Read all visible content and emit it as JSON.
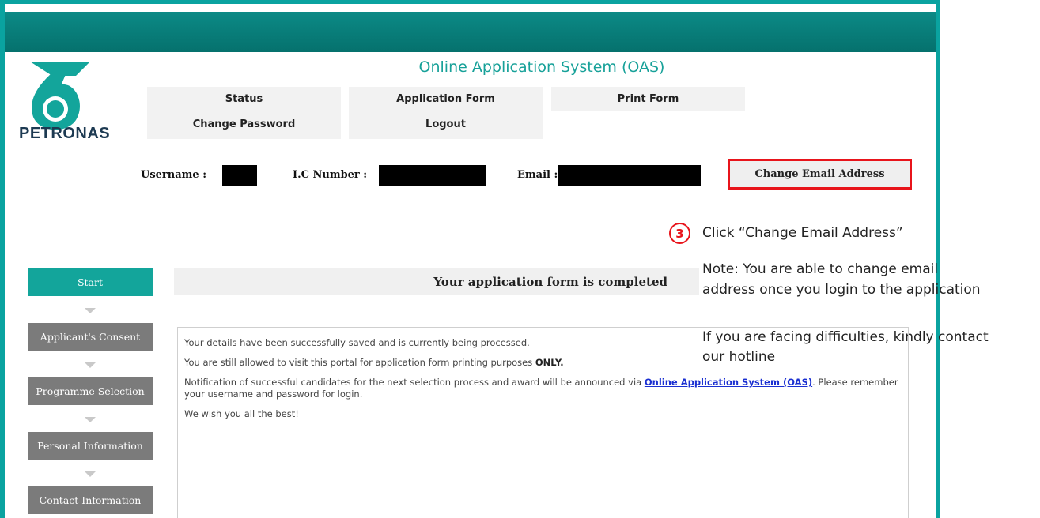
{
  "brand": {
    "logo_text": "PETRONAS",
    "accent": "#0aa3a0",
    "highlight": "#e8141b"
  },
  "header": {
    "title": "Online Application System (OAS)"
  },
  "menu": {
    "status": "Status",
    "change_password": "Change Password",
    "application_form": "Application Form",
    "logout": "Logout",
    "print_form": "Print Form"
  },
  "user_info": {
    "username_label": "Username :",
    "ic_label": "I.C Number :",
    "email_label": "Email :",
    "change_email_button": "Change Email Address"
  },
  "callout": {
    "step_number": "3",
    "instruction": "Click “Change Email Address”",
    "note_line1": "Note: You are able to change email",
    "note_line2": "address once you login to the application",
    "help_line1": "If you are facing difficulties, kindly contact",
    "help_line2": "our hotline"
  },
  "sidebar": {
    "steps": [
      "Start",
      "Applicant's Consent",
      "Programme Selection",
      "Personal Information",
      "Contact Information"
    ]
  },
  "content": {
    "heading": "Your application form is completed",
    "line1": "Your details have been successfully saved and is currently being processed.",
    "line2_pre": "You are still allowed to visit this portal for application form printing purposes ",
    "line2_bold": "ONLY.",
    "line3_pre": "Notification of successful candidates for the next selection process and award will be announced via ",
    "line3_link": "Online Application System (OAS)",
    "line3_post": ". Please remember your username and password for login.",
    "line4": "We wish you all the best!"
  }
}
